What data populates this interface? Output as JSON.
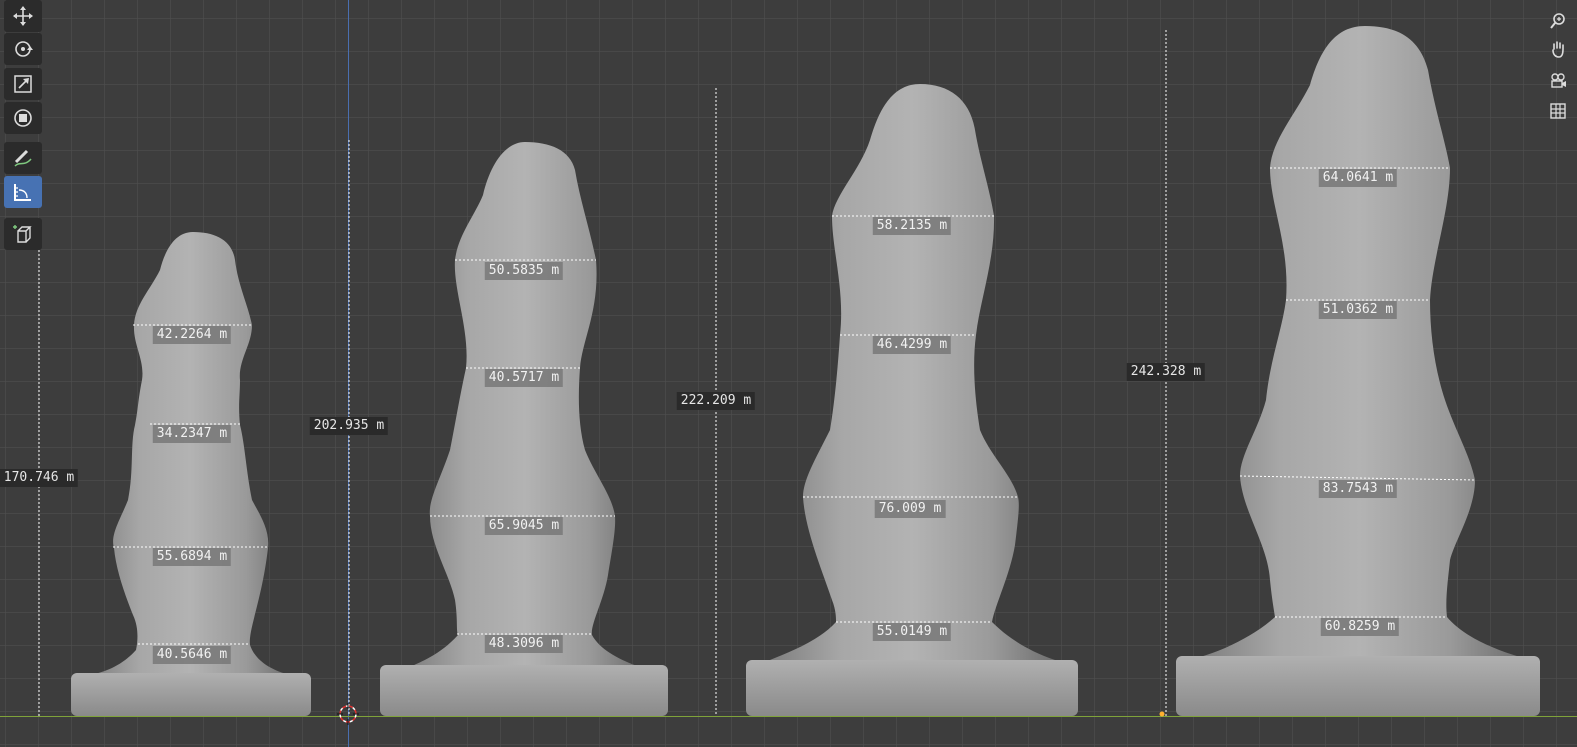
{
  "toolbar": {
    "tools": [
      {
        "icon": "move-icon",
        "active": false
      },
      {
        "icon": "rotate-icon",
        "active": false
      },
      {
        "icon": "scale-icon",
        "active": false
      },
      {
        "icon": "transform-icon",
        "active": false
      },
      {
        "icon": "annotate-icon",
        "active": false
      },
      {
        "icon": "measure-icon",
        "active": true
      },
      {
        "icon": "add-cube-icon",
        "active": false
      }
    ]
  },
  "navigation": {
    "buttons": [
      "zoom-icon",
      "pan-hand-icon",
      "camera-view-icon",
      "grid-perspective-icon"
    ]
  },
  "colors": {
    "background": "#3d3d3d",
    "grid": "#505050",
    "axis_x": "#7fa33a",
    "axis_z": "#4a6fb0",
    "model": "#9e9e9e",
    "active_tool": "#4772b3",
    "label_bg": "#2a2a2a"
  },
  "objects": [
    {
      "height": "170.746 m",
      "widths": [
        "42.2264 m",
        "34.2347 m",
        "55.6894 m",
        "40.5646 m"
      ]
    },
    {
      "height": "202.935 m",
      "widths": [
        "50.5835 m",
        "40.5717 m",
        "65.9045 m",
        "48.3096 m"
      ]
    },
    {
      "height": "222.209 m",
      "widths": [
        "58.2135 m",
        "46.4299 m",
        "76.009 m",
        "55.0149 m"
      ]
    },
    {
      "height": "242.328 m",
      "widths": [
        "64.0641 m",
        "51.0362 m",
        "83.7543 m",
        "60.8259 m"
      ]
    }
  ]
}
